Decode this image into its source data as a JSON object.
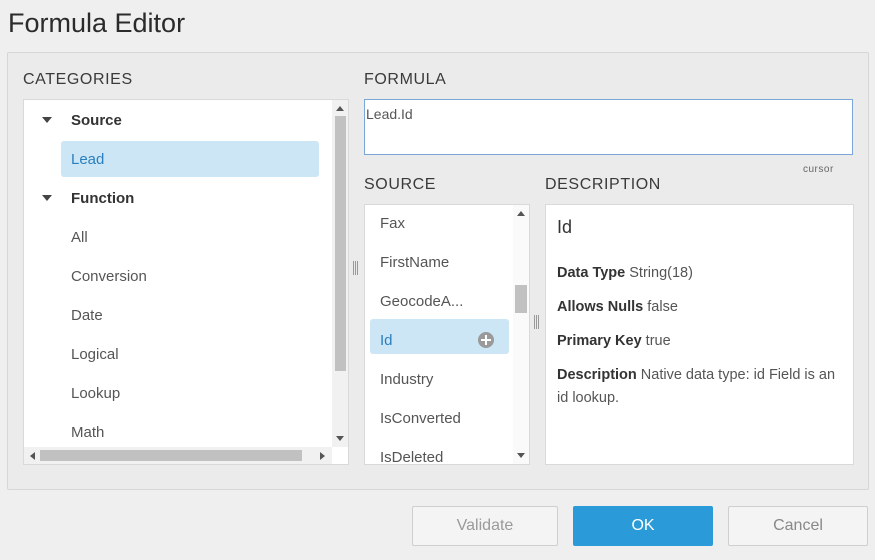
{
  "dialog": {
    "title": "Formula Editor"
  },
  "categories": {
    "label": "CATEGORIES",
    "groups": [
      {
        "label": "Source",
        "expanded": true,
        "items": [
          {
            "label": "Lead",
            "selected": true
          }
        ]
      },
      {
        "label": "Function",
        "expanded": true,
        "items": [
          {
            "label": "All"
          },
          {
            "label": "Conversion"
          },
          {
            "label": "Date"
          },
          {
            "label": "Logical"
          },
          {
            "label": "Lookup"
          },
          {
            "label": "Math"
          }
        ]
      }
    ]
  },
  "formula": {
    "label": "FORMULA",
    "value": "Lead.Id",
    "hint": "cursor"
  },
  "source": {
    "label": "SOURCE",
    "items": [
      {
        "label": "Fax"
      },
      {
        "label": "FirstName"
      },
      {
        "label": "GeocodeA..."
      },
      {
        "label": "Id",
        "selected": true
      },
      {
        "label": "Industry"
      },
      {
        "label": "IsConverted"
      },
      {
        "label": "IsDeleted"
      }
    ]
  },
  "description": {
    "label": "DESCRIPTION",
    "title": "Id",
    "fields": [
      {
        "key": "Data Type",
        "value": "String(18)"
      },
      {
        "key": "Allows Nulls",
        "value": "false"
      },
      {
        "key": "Primary Key",
        "value": "true"
      },
      {
        "key": "Description",
        "value": "Native data type: id Field is an id lookup."
      }
    ]
  },
  "buttons": {
    "validate": "Validate",
    "ok": "OK",
    "cancel": "Cancel"
  },
  "colors": {
    "primary": "#2a9ad9",
    "selection": "#cce6f5",
    "focus_border": "#7aa7d9"
  },
  "icons": {
    "tree_toggle": "caret-down-icon",
    "add_field": "plus-circle-icon",
    "splitter": "splitter-handle-icon"
  }
}
